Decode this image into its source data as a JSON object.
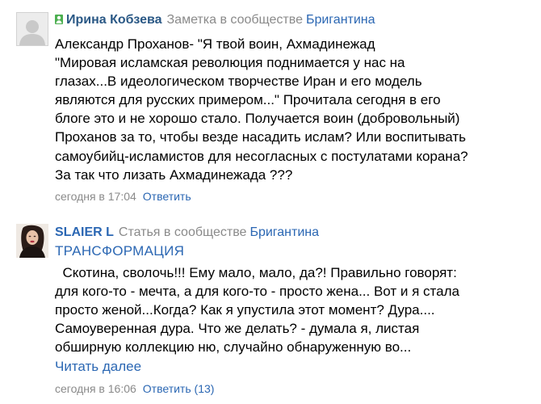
{
  "posts": [
    {
      "author": "Ирина Кобзева",
      "author_online": true,
      "post_kind": "Заметка в сообществе",
      "community": "Бригантина",
      "body_lines": [
        "Александр Проханов- \"Я твой воин, Ахмадинежад",
        "\"Мировая исламская революция поднимается у нас на",
        "глазах...В идеологическом творчестве Иран и его модель",
        "являются для русских примером...\" Прочитала сегодня в его",
        "блоге это и не хорошо стало. Получается воин (добровольный)",
        "Проханов за то, чтобы везде насадить ислам? Или воспитывать",
        "самоубийц-исламистов для несогласных с постулатами корана?",
        "За так что лизать Ахмадинежада ???"
      ],
      "timestamp": "сегодня в 17:04",
      "action": "Ответить"
    },
    {
      "author": "SLAIER L",
      "post_kind": "Статья в сообществе",
      "community": "Бригантина",
      "title": "ТРАНСФОРМАЦИЯ",
      "body_lines": [
        "  Скотина, сволочь!!! Ему мало, мало, да?! Правильно говорят:",
        "для кого-то - мечта, а для кого-то - просто жена... Вот и я стала",
        "просто женой...Когда? Как я упустила этот момент? Дура....",
        "Самоуверенная дура. Что же делать? - думала я, листая",
        "обширную коллекцию ню, случайно обнаруженную во..."
      ],
      "read_more": "Читать далее",
      "timestamp": "сегодня в 16:06",
      "action": "Ответить (13)"
    }
  ],
  "colors": {
    "link": "#2b67b3",
    "author": "#2a5885",
    "meta_gray": "#8a8a8a",
    "online_green": "#4caf50"
  },
  "icons": [
    "default-avatar-icon",
    "online-status-icon"
  ]
}
